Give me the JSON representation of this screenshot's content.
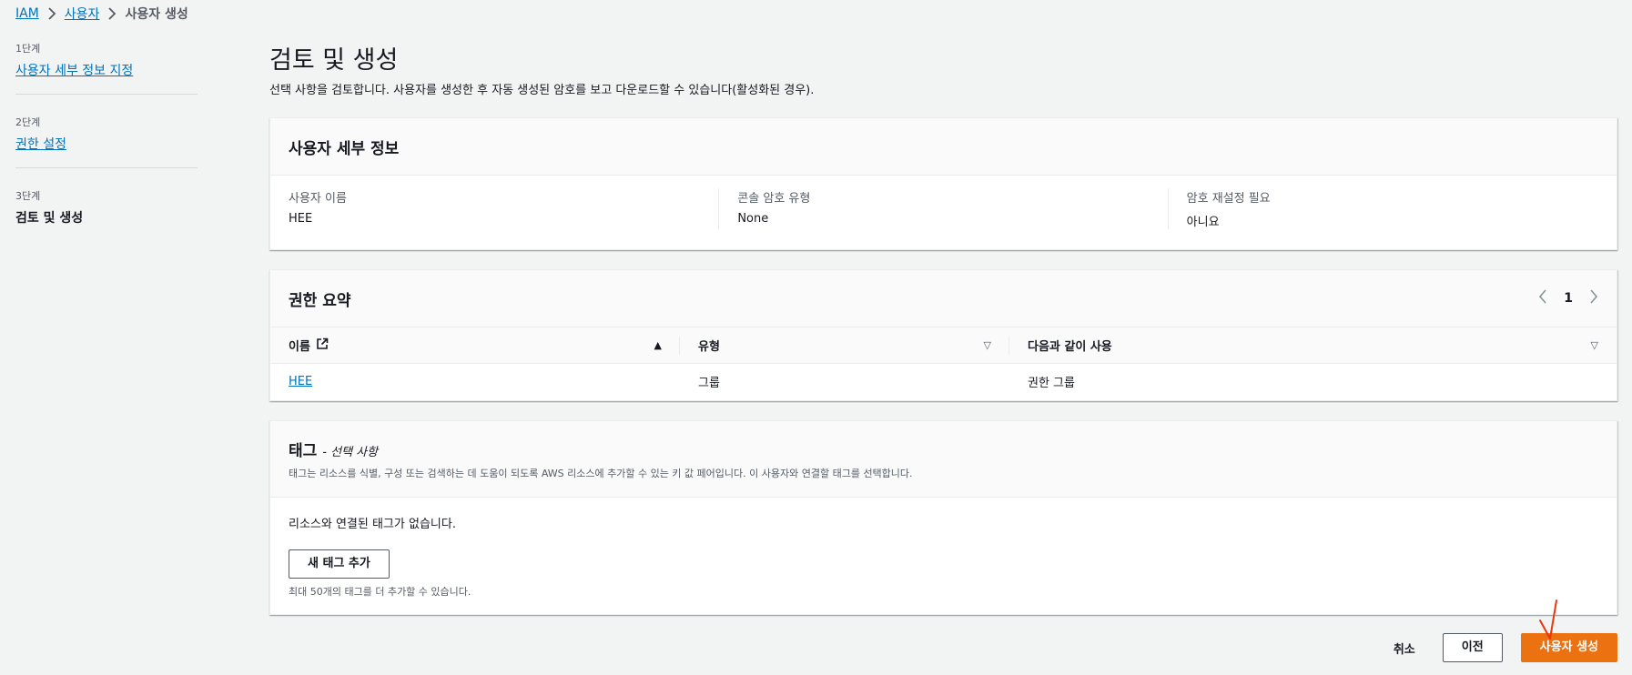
{
  "breadcrumb": {
    "items": [
      "IAM",
      "사용자"
    ],
    "current": "사용자 생성"
  },
  "steps": [
    {
      "num": "1단계",
      "label": "사용자 세부 정보 지정"
    },
    {
      "num": "2단계",
      "label": "권한 설정"
    },
    {
      "num": "3단계",
      "label": "검토 및 생성"
    }
  ],
  "page": {
    "title": "검토 및 생성",
    "description": "선택 사항을 검토합니다. 사용자를 생성한 후 자동 생성된 암호를 보고 다운로드할 수 있습니다(활성화된 경우)."
  },
  "details": {
    "title": "사용자 세부 정보",
    "fields": [
      {
        "label": "사용자 이름",
        "value": "HEE"
      },
      {
        "label": "콘솔 암호 유형",
        "value": "None"
      },
      {
        "label": "암호 재설정 필요",
        "value": "아니요"
      }
    ]
  },
  "permissions": {
    "title": "권한 요약",
    "page": "1",
    "columns": [
      "이름",
      "유형",
      "다음과 같이 사용"
    ],
    "rows": [
      {
        "name": "HEE",
        "type": "그룹",
        "used_as": "권한 그룹"
      }
    ]
  },
  "tags": {
    "title": "태그",
    "optional": "- 선택 사항",
    "description": "태그는 리소스를 식별, 구성 또는 검색하는 데 도움이 되도록 AWS 리소스에 추가할 수 있는 키 값 페어입니다. 이 사용자와 연결할 태그를 선택합니다.",
    "empty": "리소스와 연결된 태그가 없습니다.",
    "add_button": "새 태그 추가",
    "hint": "최대 50개의 태그를 더 추가할 수 있습니다."
  },
  "actions": {
    "cancel": "취소",
    "previous": "이전",
    "create": "사용자 생성"
  },
  "colors": {
    "primary": "#ec7211",
    "link": "#0073bb",
    "annotation": "#e8360f"
  }
}
